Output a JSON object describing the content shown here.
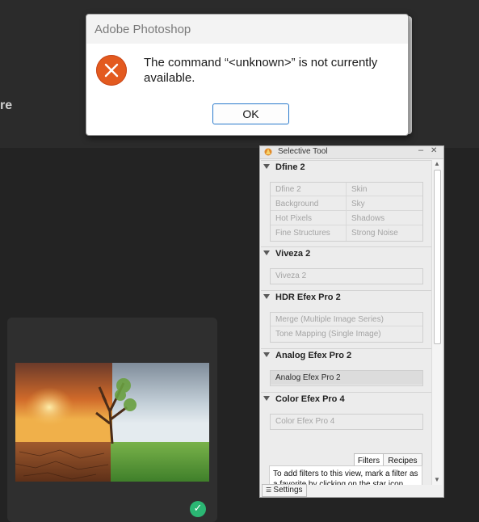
{
  "background": {
    "fragment_text": "re"
  },
  "dialog": {
    "title": "Adobe Photoshop",
    "message": "The command “<unknown>” is not currently available.",
    "ok_label": "OK",
    "icon": "error-circle-icon"
  },
  "panel": {
    "title": "Selective Tool",
    "sections": [
      {
        "name": "Dfine 2",
        "items": [
          "Dfine 2",
          "Skin",
          "Background",
          "Sky",
          "Hot Pixels",
          "Shadows",
          "Fine Structures",
          "Strong Noise"
        ]
      },
      {
        "name": "Viveza 2",
        "items": [
          "Viveza 2"
        ]
      },
      {
        "name": "HDR Efex Pro 2",
        "items": [
          "Merge (Multiple Image Series)",
          "Tone Mapping (Single Image)"
        ]
      },
      {
        "name": "Analog Efex Pro 2",
        "items": [
          "Analog Efex Pro 2"
        ]
      },
      {
        "name": "Color Efex Pro 4",
        "items": [
          "Color Efex Pro 4"
        ]
      }
    ],
    "tabs": [
      "Filters",
      "Recipes"
    ],
    "info_text": "To add filters to this view, mark a filter as a favorite by clicking on the star icon next to the filter name",
    "settings_label": "Settings"
  },
  "colors": {
    "error_icon": "#e35a1f",
    "ok_border": "#2a7acc",
    "check_badge": "#2bb673"
  }
}
